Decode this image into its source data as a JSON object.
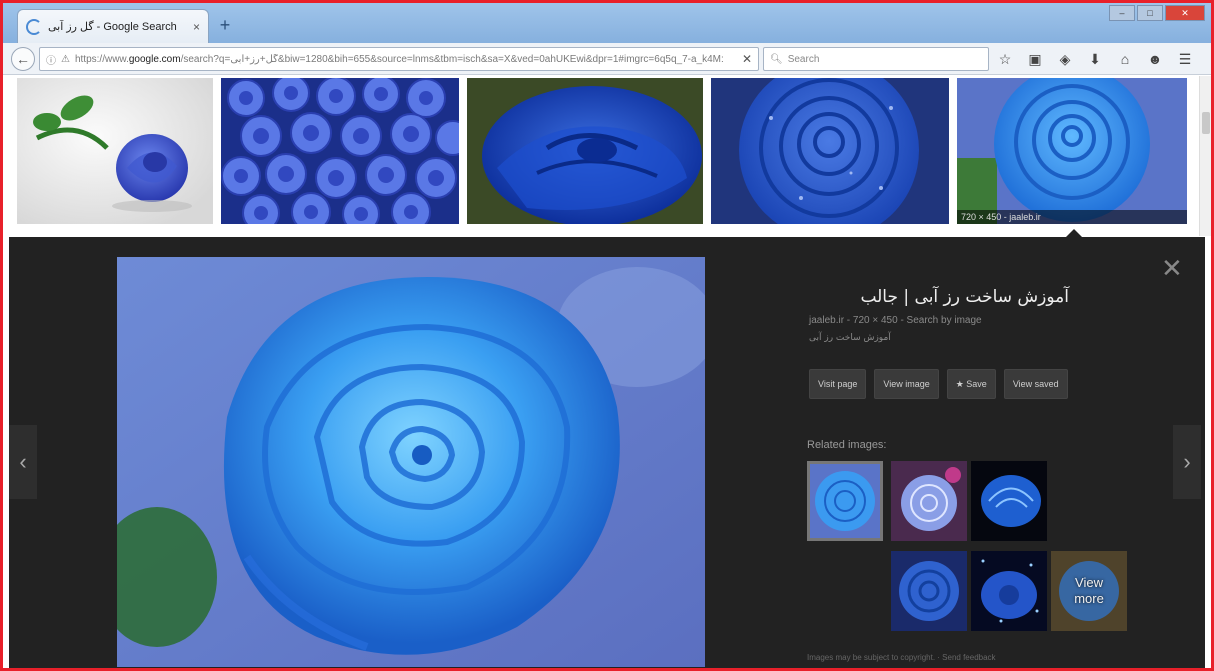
{
  "browser": {
    "tab_title": "گل رز آبی - Google Search",
    "tab_close": "×",
    "new_tab": "+",
    "back": "←",
    "url_prefix": "https://www.",
    "url_domain": "google.com",
    "url_rest": "/search?q=گل+رز+آبی&biw=1280&bih=655&source=lnms&tbm=isch&sa=X&ved=0ahUKEwi&dpr=1#imgrc=6q5q_7-a_k4M:",
    "search_placeholder": "Search",
    "search_icon": "magnifier-icon",
    "window_controls": [
      "–",
      "□",
      "✕"
    ]
  },
  "results": {
    "thumb5_caption": "720 × 450 - jaaleb.ir"
  },
  "preview": {
    "title": "آموزش ساخت رز آبی | جالب",
    "meta": "jaaleb.ir - 720 × 450 - Search by image",
    "description": "آموزش ساخت رز آبی",
    "buttons": {
      "visit": "Visit page",
      "view_image": "View image",
      "save": "★ Save",
      "view_saved": "View saved"
    },
    "related_label": "Related images:",
    "view_more": "View\nmore",
    "footer": "Images may be subject to copyright. · Send feedback",
    "close": "✕",
    "prev": "‹",
    "next": "›"
  },
  "colors": {
    "accent_frame": "#e8202a",
    "panel_bg": "#222222",
    "rose_blue": "#2a63c9"
  }
}
